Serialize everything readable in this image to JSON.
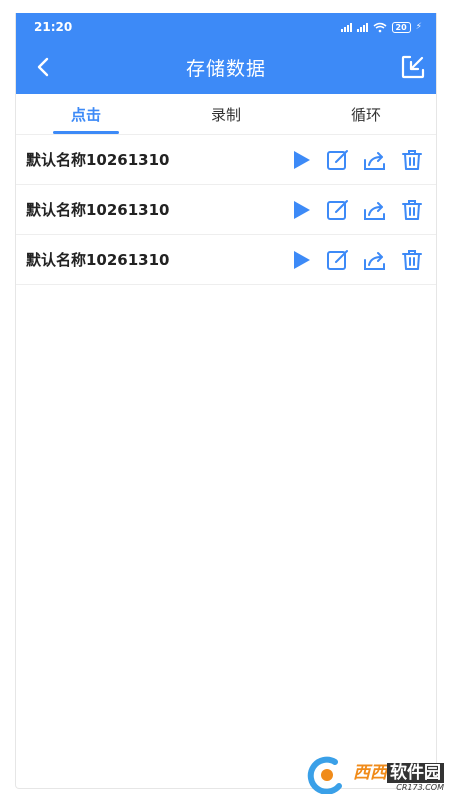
{
  "status_bar": {
    "time": "21:20",
    "battery": "20"
  },
  "header": {
    "title": "存储数据",
    "back_icon": "chevron-left-icon",
    "export_icon": "export-icon"
  },
  "tabs": [
    {
      "label": "点击",
      "active": true
    },
    {
      "label": "录制",
      "active": false
    },
    {
      "label": "循环",
      "active": false
    }
  ],
  "rows": [
    {
      "name": "默认名称10261310"
    },
    {
      "name": "默认名称10261310"
    },
    {
      "name": "默认名称10261310"
    }
  ],
  "row_action_icons": [
    "play-icon",
    "edit-icon",
    "share-icon",
    "delete-icon"
  ],
  "watermark": {
    "brand_a": "西西",
    "brand_b": "软件园",
    "url": "CR173.COM"
  },
  "colors": {
    "accent": "#3d8af7",
    "text": "#222222",
    "divider": "#eeeeee"
  }
}
